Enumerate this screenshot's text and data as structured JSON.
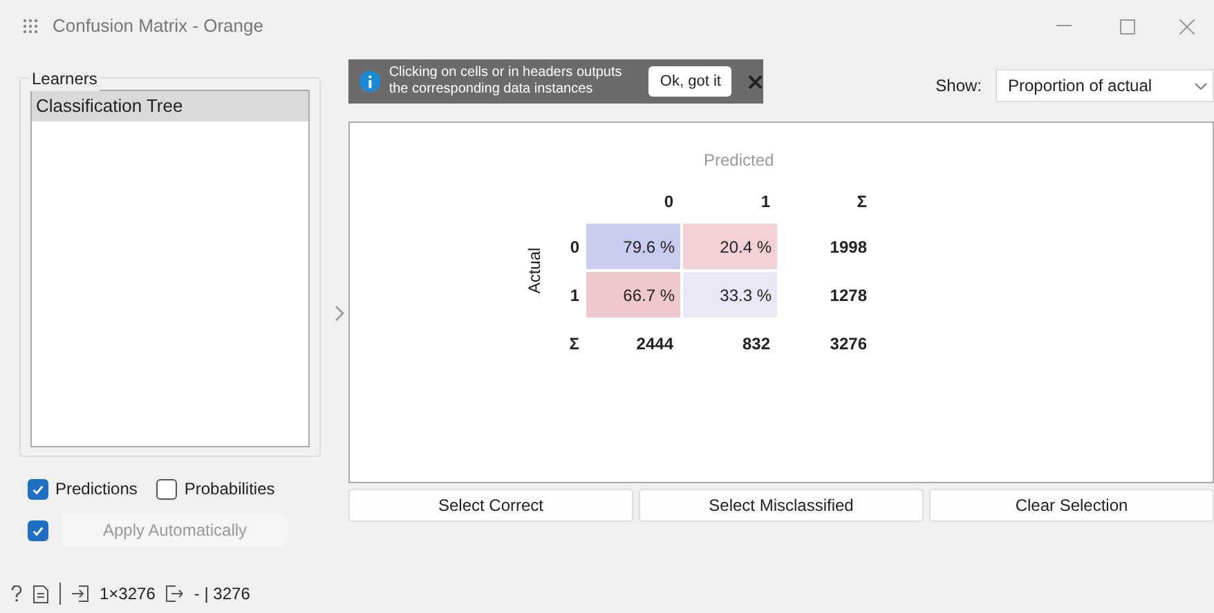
{
  "window": {
    "title": "Confusion Matrix - Orange"
  },
  "learners": {
    "title": "Learners",
    "items": [
      {
        "label": "Classification Tree",
        "selected": true
      }
    ]
  },
  "options": [
    {
      "label": "Predictions",
      "checked": true
    },
    {
      "label": "Probabilities",
      "checked": false
    }
  ],
  "apply": {
    "checked": true,
    "label": "Apply Automatically"
  },
  "info": {
    "text": "Clicking on cells or in headers outputs the corresponding data instances",
    "button": "Ok, got it"
  },
  "show": {
    "label": "Show:",
    "value": "Proportion of actual"
  },
  "matrix": {
    "predicted_label": "Predicted",
    "actual_label": "Actual",
    "columns": [
      "0",
      "1",
      "Σ"
    ],
    "rows": [
      {
        "label": "0",
        "cells": [
          {
            "text": "79.6 %",
            "color": "#c9cbef"
          },
          {
            "text": "20.4 %",
            "color": "#f2d0d3"
          }
        ],
        "total": "1998"
      },
      {
        "label": "1",
        "cells": [
          {
            "text": "66.7 %",
            "color": "#efc8cc"
          },
          {
            "text": "33.3 %",
            "color": "#e8e8f6"
          }
        ],
        "total": "1278"
      }
    ],
    "sums": {
      "label": "Σ",
      "values": [
        "2444",
        "832",
        "3276"
      ]
    }
  },
  "buttons": [
    "Select Correct",
    "Select Misclassified",
    "Clear Selection"
  ],
  "status": {
    "input": "1×3276",
    "output": "- | 3276"
  }
}
